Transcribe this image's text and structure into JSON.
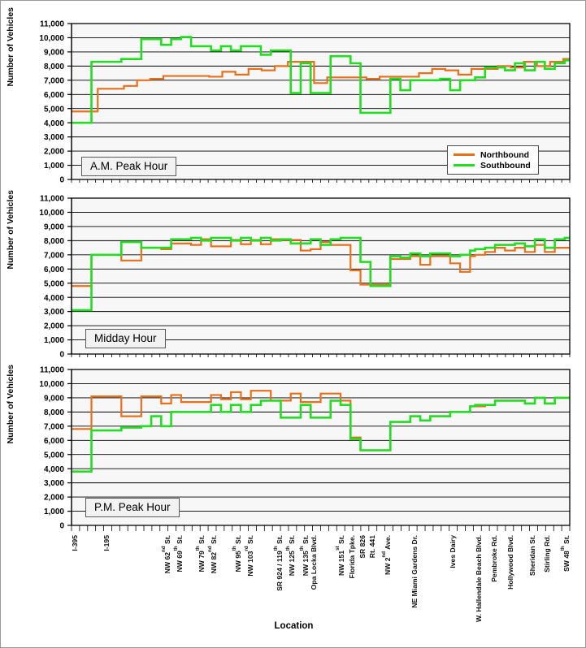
{
  "axes": {
    "ylabel": "Number of Vehicles",
    "xlabel": "Location",
    "yticks": [
      "0",
      "1,000",
      "2,000",
      "3,000",
      "4,000",
      "5,000",
      "6,000",
      "7,000",
      "8,000",
      "9,000",
      "10,000",
      "11,000"
    ],
    "ylim": [
      0,
      11000
    ]
  },
  "legend": {
    "position": "bottom-right-panel-1",
    "items": [
      {
        "label": "Northbound",
        "color": "#E8701A"
      },
      {
        "label": "Southbound",
        "color": "#22DD22"
      }
    ]
  },
  "panels": [
    {
      "id": "am",
      "callout": "A.M. Peak Hour"
    },
    {
      "id": "md",
      "callout": "Midday Hour"
    },
    {
      "id": "pm",
      "callout": "P.M. Peak Hour"
    }
  ],
  "locations": [
    {
      "label": "I-395",
      "pos": 0.5
    },
    {
      "label": "I-195",
      "pos": 4.5
    },
    {
      "label": "NW 62",
      "sup": "nd",
      "tail": " St.",
      "pos": 11.5
    },
    {
      "label": "NW 69",
      "sup": "th",
      "tail": " St.",
      "pos": 13.0
    },
    {
      "label": "NW 79",
      "sup": "th",
      "tail": " St.",
      "pos": 15.8
    },
    {
      "label": "NW 82",
      "sup": "nd",
      "tail": " St.",
      "pos": 17.3
    },
    {
      "label": "NW 95",
      "sup": "th",
      "tail": " St.",
      "pos": 20.3
    },
    {
      "label": "NW 103",
      "sup": "rd",
      "tail": " St.",
      "pos": 21.8
    },
    {
      "label": "SR 924 / 119",
      "sup": "th",
      "tail": " St.",
      "pos": 25.5
    },
    {
      "label": "NW 125",
      "sup": "th",
      "tail": " St.",
      "pos": 27.0
    },
    {
      "label": "NW 135",
      "sup": "th",
      "tail": " St.",
      "pos": 28.7
    },
    {
      "label": "Opa Locka Blvd.",
      "pos": 30.2
    },
    {
      "label": "NW 151",
      "sup": "st",
      "tail": " St.",
      "pos": 33.2
    },
    {
      "label": "Florida Tpke.",
      "pos": 35.0
    },
    {
      "label": "SR 826",
      "pos": 36.3
    },
    {
      "label": "Rt. 441",
      "pos": 37.5
    },
    {
      "label": "NW 2",
      "sup": "nd",
      "tail": " Ave.",
      "pos": 38.9
    },
    {
      "label": "NE Miami Gardens Dr.",
      "pos": 42.8
    },
    {
      "label": "Ives Dairy",
      "pos": 47.5
    },
    {
      "label": "W. Hallendale Beach Blvd.",
      "pos": 50.8
    },
    {
      "label": "Pembroke Rd.",
      "pos": 52.7
    },
    {
      "label": "Hollywood Blvd.",
      "pos": 54.7
    },
    {
      "label": "Sheridan St.",
      "pos": 57.4
    },
    {
      "label": "Stirling Rd.",
      "pos": 59.3
    },
    {
      "label": "SW 48",
      "sup": "th",
      "tail": " St.",
      "pos": 61.2
    }
  ],
  "chart_data": [
    {
      "type": "line",
      "subtype": "step",
      "title": "A.M. Peak Hour",
      "xlabel": "Location",
      "ylabel": "Number of Vehicles",
      "ylim": [
        0,
        11000
      ],
      "grid": true,
      "series": [
        {
          "name": "Northbound",
          "color": "#E8701A",
          "values": [
            4800,
            4800,
            4800,
            4800,
            6400,
            6400,
            6400,
            6400,
            6600,
            6600,
            7000,
            7000,
            7100,
            7100,
            7300,
            7300,
            7300,
            7300,
            7300,
            7300,
            7300,
            7250,
            7250,
            7600,
            7600,
            7400,
            7400,
            7800,
            7800,
            7700,
            7700,
            8000,
            8000,
            8300,
            8300,
            8300,
            8300,
            6800,
            6800,
            7200,
            7200,
            7200,
            7200,
            7200,
            7200,
            7100,
            7100,
            7250,
            7250,
            7250,
            7250,
            7250,
            7250,
            7500,
            7500,
            7800,
            7800,
            7700,
            7700,
            7400,
            7400,
            7800,
            7800,
            7800,
            7800,
            8000,
            8000,
            7900,
            7900,
            8300,
            8300,
            8000,
            8000,
            8300,
            8300,
            8500
          ]
        },
        {
          "name": "Southbound",
          "color": "#22DD22",
          "values": [
            4000,
            4000,
            4000,
            4000,
            8300,
            8300,
            8300,
            8300,
            8300,
            8300,
            8500,
            8500,
            8500,
            8500,
            9900,
            9900,
            9900,
            9900,
            9500,
            9500,
            9900,
            9900,
            10050,
            10050,
            9400,
            9400,
            9400,
            9400,
            9100,
            9100,
            9400,
            9400,
            9100,
            9100,
            9400,
            9400,
            9400,
            9400,
            8800,
            8800,
            9100,
            9100,
            9100,
            9100,
            6100,
            6100,
            8200,
            8200,
            6100,
            6100,
            6100,
            6100,
            8700,
            8700,
            8700,
            8700,
            8200,
            8200,
            4700,
            4700,
            4700,
            4700,
            4700,
            4700,
            7100,
            7100,
            6300,
            6300,
            7000,
            7000,
            7000,
            7000,
            7000,
            7000,
            7100,
            7100,
            6300,
            6300,
            7000,
            7000,
            7000,
            7200,
            7200,
            7900,
            7900,
            7900,
            7900,
            7700,
            7700,
            8200,
            8200,
            7700,
            7700,
            8300,
            8300,
            7800,
            7800,
            8200,
            8200,
            8400
          ]
        }
      ]
    },
    {
      "type": "line",
      "subtype": "step",
      "title": "Midday Hour",
      "xlabel": "Location",
      "ylabel": "Number of Vehicles",
      "ylim": [
        0,
        11000
      ],
      "grid": true,
      "series": [
        {
          "name": "Northbound",
          "color": "#E8701A",
          "values": [
            4800,
            4800,
            4800,
            4800,
            7000,
            7000,
            7000,
            7000,
            7000,
            7000,
            6600,
            6600,
            6600,
            6600,
            7500,
            7500,
            7500,
            7500,
            7400,
            7400,
            7800,
            7800,
            7800,
            7800,
            7700,
            7700,
            8100,
            8100,
            7600,
            7600,
            7600,
            7600,
            8050,
            8050,
            7750,
            7750,
            8050,
            8050,
            7750,
            7750,
            8100,
            8100,
            8050,
            8050,
            8050,
            8050,
            7300,
            7300,
            7400,
            7400,
            7900,
            7900,
            7700,
            7700,
            7700,
            7700,
            5900,
            5900,
            4900,
            4900,
            4900,
            4900,
            4900,
            4900,
            6700,
            6700,
            6700,
            6700,
            6900,
            6900,
            6300,
            6300,
            6900,
            6900,
            6900,
            6900,
            6400,
            6400,
            5800,
            5800,
            6900,
            7000,
            7000,
            7200,
            7200,
            7500,
            7500,
            7300,
            7300,
            7500,
            7500,
            7200,
            7200,
            7700,
            7700,
            7200,
            7200,
            7500,
            7500,
            7500
          ]
        },
        {
          "name": "Southbound",
          "color": "#22DD22",
          "values": [
            3100,
            3100,
            3100,
            3100,
            7000,
            7000,
            7000,
            7000,
            7000,
            7000,
            7900,
            7900,
            7900,
            7900,
            7500,
            7500,
            7500,
            7500,
            7500,
            7500,
            8100,
            8100,
            8100,
            8100,
            8200,
            8200,
            8000,
            8000,
            8200,
            8200,
            8200,
            8200,
            8000,
            8000,
            8200,
            8200,
            8000,
            8000,
            8200,
            8200,
            8000,
            8000,
            8100,
            8100,
            7800,
            7800,
            7800,
            7800,
            8100,
            8100,
            7700,
            7700,
            8100,
            8100,
            8200,
            8200,
            8200,
            8200,
            6500,
            6500,
            4800,
            4800,
            4800,
            4800,
            6900,
            6900,
            6800,
            6800,
            7100,
            7100,
            6900,
            6900,
            7100,
            7100,
            7100,
            7100,
            6900,
            6900,
            7000,
            7000,
            7300,
            7400,
            7400,
            7500,
            7500,
            7700,
            7700,
            7700,
            7700,
            7800,
            7800,
            7600,
            7600,
            8100,
            8100,
            7500,
            7500,
            8100,
            8100,
            8200
          ]
        }
      ]
    },
    {
      "type": "line",
      "subtype": "step",
      "title": "P.M. Peak Hour",
      "xlabel": "Location",
      "ylabel": "Number of Vehicles",
      "ylim": [
        0,
        11000
      ],
      "grid": true,
      "series": [
        {
          "name": "Northbound",
          "color": "#E8701A",
          "values": [
            6800,
            6800,
            6800,
            6800,
            9100,
            9100,
            9100,
            9100,
            9100,
            9100,
            7700,
            7700,
            7700,
            7700,
            9100,
            9100,
            9100,
            9100,
            8600,
            8600,
            9200,
            9200,
            8700,
            8700,
            8700,
            8700,
            8700,
            8700,
            9200,
            9200,
            8900,
            8900,
            9400,
            9400,
            8900,
            8900,
            9500,
            9500,
            9500,
            9500,
            8800,
            8800,
            8800,
            8800,
            9300,
            9300,
            8700,
            8700,
            8700,
            8700,
            9300,
            9300,
            9300,
            9300,
            8800,
            8800,
            6200,
            6200,
            5300,
            5300,
            5300,
            5300,
            5300,
            5300,
            7300,
            7300,
            7300,
            7300,
            7700,
            7700,
            7400,
            7400,
            7700,
            7700,
            7700,
            7700,
            8000,
            8000,
            8000,
            8000,
            8400,
            8400,
            8400,
            8500,
            8500,
            8800,
            8800,
            8800,
            8800,
            8800,
            8800,
            8600,
            8600,
            9000,
            9000,
            8600,
            8600,
            9000,
            9000,
            9000
          ]
        },
        {
          "name": "Southbound",
          "color": "#22DD22",
          "values": [
            3800,
            3800,
            3800,
            3800,
            6700,
            6700,
            6700,
            6700,
            6700,
            6700,
            6900,
            6900,
            6900,
            6900,
            7000,
            7000,
            7700,
            7700,
            7000,
            7000,
            8000,
            8000,
            8000,
            8000,
            8000,
            8000,
            8000,
            8000,
            8500,
            8500,
            8000,
            8000,
            8500,
            8500,
            8000,
            8000,
            8500,
            8500,
            8800,
            8800,
            8800,
            8800,
            7600,
            7600,
            7600,
            7600,
            8500,
            8500,
            7600,
            7600,
            7600,
            7600,
            8800,
            8800,
            8500,
            8500,
            6100,
            6100,
            5300,
            5300,
            5300,
            5300,
            5300,
            5300,
            7300,
            7300,
            7300,
            7300,
            7700,
            7700,
            7400,
            7400,
            7700,
            7700,
            7700,
            7700,
            8000,
            8000,
            8000,
            8000,
            8400,
            8500,
            8500,
            8500,
            8500,
            8800,
            8800,
            8800,
            8800,
            8800,
            8800,
            8600,
            8600,
            9000,
            9000,
            8600,
            8600,
            9000,
            9000,
            9000
          ]
        }
      ]
    }
  ]
}
